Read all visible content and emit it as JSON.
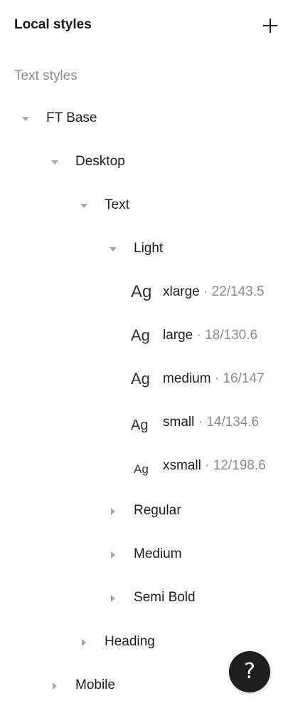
{
  "header": {
    "title": "Local styles",
    "add_icon": "plus-icon"
  },
  "section": {
    "label": "Text styles"
  },
  "tree": [
    {
      "id": "ft-base",
      "label": "FT Base",
      "expanded": true,
      "depth": 0
    },
    {
      "id": "desktop",
      "label": "Desktop",
      "expanded": true,
      "depth": 1
    },
    {
      "id": "text",
      "label": "Text",
      "expanded": true,
      "depth": 2
    },
    {
      "id": "light",
      "label": "Light",
      "expanded": true,
      "depth": 3
    },
    {
      "id": "regular",
      "label": "Regular",
      "expanded": false,
      "depth": 3
    },
    {
      "id": "medium",
      "label": "Medium",
      "expanded": false,
      "depth": 3
    },
    {
      "id": "semi-bold",
      "label": "Semi Bold",
      "expanded": false,
      "depth": 3
    },
    {
      "id": "heading",
      "label": "Heading",
      "expanded": false,
      "depth": 2
    },
    {
      "id": "mobile",
      "label": "Mobile",
      "expanded": false,
      "depth": 1
    }
  ],
  "styles": [
    {
      "preview": "Ag",
      "name": "xlarge",
      "meta": " · 22/143.5"
    },
    {
      "preview": "Ag",
      "name": "large",
      "meta": " · 18/130.6"
    },
    {
      "preview": "Ag",
      "name": "medium",
      "meta": " · 16/147"
    },
    {
      "preview": "Ag",
      "name": "small",
      "meta": " · 14/134.6"
    },
    {
      "preview": "Ag",
      "name": "xsmall",
      "meta": " · 12/198.6"
    }
  ],
  "help": {
    "label": "?",
    "icon": "question-mark-icon"
  },
  "colors": {
    "text": "#1e1e1e",
    "muted": "#8c8c8c",
    "chevron": "#a6a6a6",
    "help_bg": "#1e1e1e"
  }
}
